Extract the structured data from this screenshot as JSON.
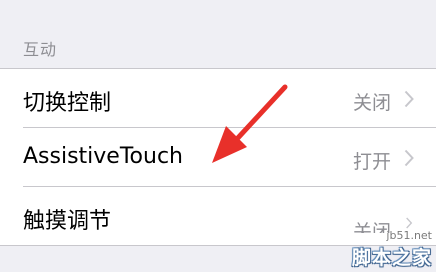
{
  "section": {
    "title": "互动"
  },
  "rows": [
    {
      "label": "切换控制",
      "value": "关闭"
    },
    {
      "label": "AssistiveTouch",
      "value": "打开"
    },
    {
      "label": "触摸调节",
      "value": "关闭"
    }
  ],
  "annotation": {
    "arrow_color": "#e8302a"
  },
  "watermark": {
    "url": "jb51.net",
    "brand": "脚本之家"
  },
  "colors": {
    "background": "#efeff4",
    "cell": "#ffffff",
    "secondary_text": "#8e8e93",
    "separator": "#c8c7cc"
  }
}
